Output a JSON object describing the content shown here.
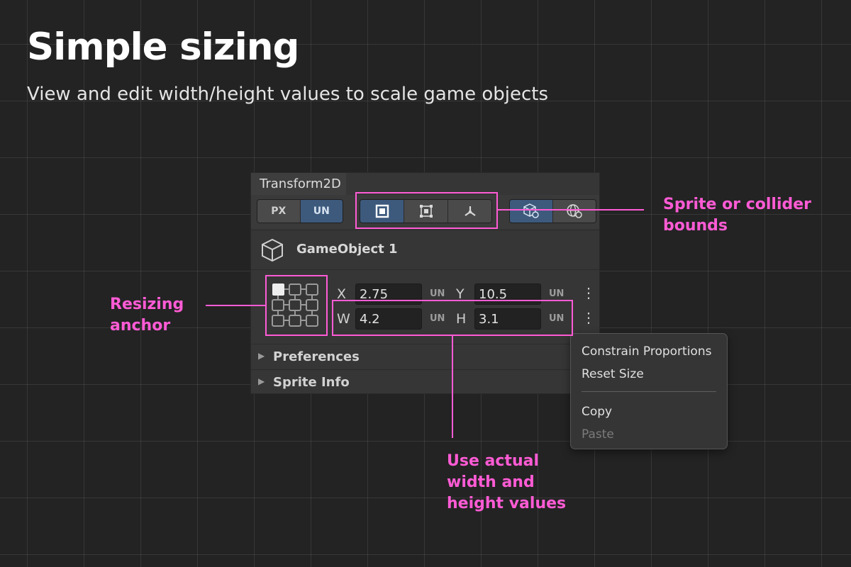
{
  "header": {
    "title": "Simple sizing",
    "subtitle": "View and edit width/height values to scale game objects"
  },
  "panel": {
    "tab_title": "Transform2D",
    "units": {
      "px_label": "PX",
      "un_label": "UN",
      "active": "UN"
    },
    "bounds_modes": [
      {
        "icon": "square-bounds-icon",
        "active": true
      },
      {
        "icon": "collider-bounds-icon",
        "active": false
      },
      {
        "icon": "pivot-axes-icon",
        "active": false
      }
    ],
    "space_modes": [
      {
        "icon": "local-space-icon",
        "active": true
      },
      {
        "icon": "world-space-icon",
        "active": false
      }
    ],
    "object_name": "GameObject 1",
    "object_icon": "cube-icon",
    "anchor_selected": "top-left",
    "fields": {
      "x": {
        "label": "X",
        "value": "2.75",
        "unit": "UN"
      },
      "y": {
        "label": "Y",
        "value": "10.5",
        "unit": "UN"
      },
      "w": {
        "label": "W",
        "value": "4.2",
        "unit": "UN"
      },
      "h": {
        "label": "H",
        "value": "3.1",
        "unit": "UN"
      }
    },
    "sections": [
      "Preferences",
      "Sprite Info"
    ]
  },
  "context_menu": {
    "items": [
      {
        "label": "Constrain Proportions",
        "enabled": true
      },
      {
        "label": "Reset Size",
        "enabled": true
      },
      {
        "label": "Copy",
        "enabled": true
      },
      {
        "label": "Paste",
        "enabled": false
      }
    ]
  },
  "callouts": {
    "bounds": "Sprite or collider bounds",
    "anchor": "Resizing anchor",
    "size": "Use actual width and height values"
  },
  "colors": {
    "background": "#232323",
    "accent_pink": "#ff5bd5",
    "active_button": "#3d5a7d",
    "panel": "#363636"
  }
}
